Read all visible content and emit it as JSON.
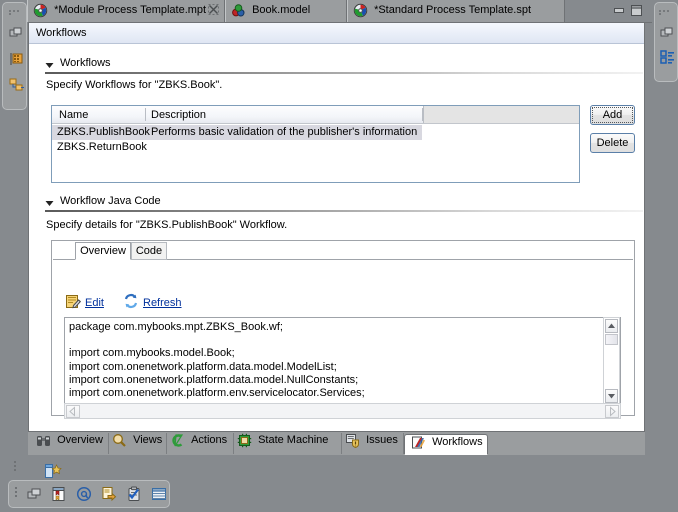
{
  "window": {
    "minimize_label": "Minimize",
    "maximize_label": "Maximize"
  },
  "editor_tabs": [
    {
      "label": "*Module Process Template.mpt",
      "icon": "process-template-icon",
      "active": true,
      "closable": true
    },
    {
      "label": "Book.model",
      "icon": "model-icon",
      "active": false,
      "closable": false
    },
    {
      "label": "*Standard Process Template.spt",
      "icon": "process-template-icon",
      "active": false,
      "closable": false
    }
  ],
  "form": {
    "header_title": "Workflows"
  },
  "sections": {
    "workflows": {
      "title": "Workflows",
      "description": "Specify Workflows for \"ZBKS.Book\"."
    },
    "java_code": {
      "title": "Workflow Java Code",
      "description": "Specify details for \"ZBKS.PublishBook\" Workflow."
    }
  },
  "table": {
    "columns": [
      "Name",
      "Description"
    ],
    "rows": [
      {
        "name": "ZBKS.PublishBook",
        "description": "Performs basic validation of the publisher's information",
        "selected": true
      },
      {
        "name": "ZBKS.ReturnBook",
        "description": "",
        "selected": false
      }
    ]
  },
  "buttons": {
    "add": "Add",
    "delete": "Delete"
  },
  "detail_tabs": [
    {
      "label": "Overview",
      "active": true
    },
    {
      "label": "Code",
      "active": false
    }
  ],
  "actions": {
    "edit": "Edit",
    "refresh": "Refresh"
  },
  "code": {
    "text": "package com.mybooks.mpt.ZBKS_Book.wf;\n\nimport com.mybooks.model.Book;\nimport com.onenetwork.platform.data.model.ModelList;\nimport com.onenetwork.platform.data.model.NullConstants;\nimport com.onenetwork.platform.env.servicelocator.Services;"
  },
  "bottom_tabs": [
    {
      "label": "Overview",
      "icon": "binoculars-icon",
      "active": false
    },
    {
      "label": "Views",
      "icon": "magnifier-icon",
      "active": false
    },
    {
      "label": "Actions",
      "icon": "action-icon",
      "active": false
    },
    {
      "label": "State Machine",
      "icon": "chip-icon",
      "active": false
    },
    {
      "label": "Issues",
      "icon": "issues-shield-icon",
      "active": false
    },
    {
      "label": "Workflows",
      "icon": "workflows-icon",
      "active": true
    }
  ],
  "left_rail_icons": [
    "restore-view-icon",
    "database-icon",
    "hierarchy-icon"
  ],
  "right_rail_icons": [
    "restore-view-icon",
    "outline-icon"
  ],
  "status_toolbar_icons": [
    "restore-icon",
    "bookmarks-icon",
    "at-icon",
    "export-icon",
    "tasks-icon",
    "grid-icon"
  ],
  "status_solo_icon": "new-item-icon",
  "colors": {
    "desktop": "#868a8e",
    "tab_bar": "#9a9d9f",
    "client": "#ffffff",
    "form_header_top": "#f5f8fd",
    "form_header_bottom": "#dfe6f3",
    "link": "#00309c",
    "selection": "#d8d8e0",
    "table_border": "#7f9db9",
    "button_border": "#5a7fa8"
  }
}
